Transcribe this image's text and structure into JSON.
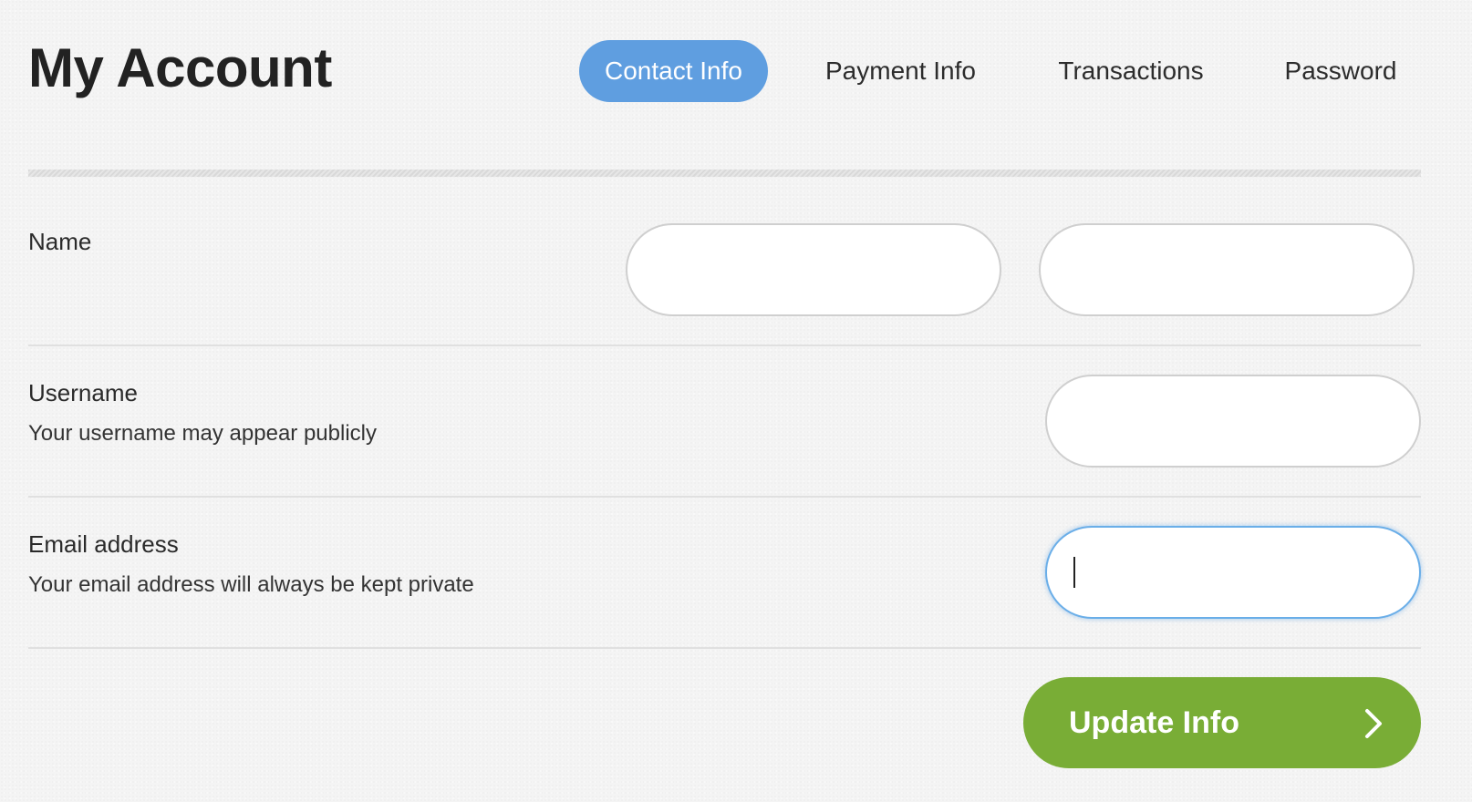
{
  "header": {
    "title": "My Account"
  },
  "tabs": [
    {
      "label": "Contact Info",
      "active": true
    },
    {
      "label": "Payment Info",
      "active": false
    },
    {
      "label": "Transactions",
      "active": false
    },
    {
      "label": "Password",
      "active": false
    }
  ],
  "form": {
    "name": {
      "label": "Name",
      "first_value": "",
      "last_value": ""
    },
    "username": {
      "label": "Username",
      "hint": "Your username may appear publicly",
      "value": ""
    },
    "email": {
      "label": "Email address",
      "hint": "Your email address will always be kept private",
      "value": "",
      "focused": true
    }
  },
  "submit": {
    "label": "Update Info",
    "icon": "chevron-right-icon"
  },
  "colors": {
    "active_tab": "#5f9ee0",
    "submit_button": "#79ad36",
    "focus_ring": "#6aaee8"
  }
}
